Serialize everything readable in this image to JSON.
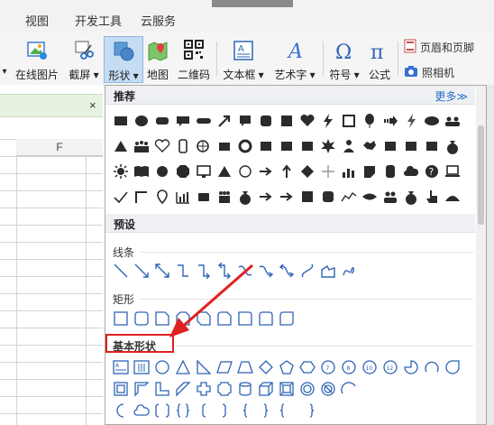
{
  "menubar": {
    "items": [
      "视图",
      "开发工具",
      "云服务"
    ]
  },
  "ribbon": {
    "online_pic": "在线图片",
    "screenshot": "截屏",
    "shape": "形状",
    "map": "地图",
    "qrcode": "二维码",
    "textbox": "文本框",
    "wordart": "艺术字",
    "symbol": "符号",
    "formula": "公式",
    "header_footer": "页眉和页脚",
    "camera": "照相机"
  },
  "sheet": {
    "col_f": "F",
    "close": "×"
  },
  "panel": {
    "recommend": "推荐",
    "more": "更多≫",
    "preset": "预设",
    "lines": "线条",
    "rect": "矩形",
    "basic": "基本形状"
  },
  "colors": {
    "accent": "#2a6fc9",
    "icon_dark": "#2b2b2b",
    "icon_blue": "#2f64b5",
    "highlight": "#e02020"
  }
}
